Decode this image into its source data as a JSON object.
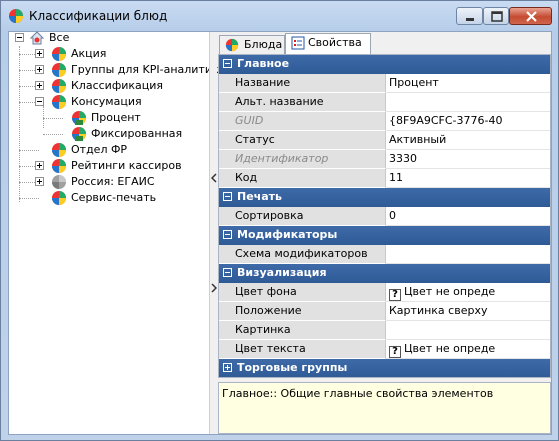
{
  "window": {
    "title": "Классификации блюд"
  },
  "tree": {
    "root": "Все",
    "items": [
      {
        "label": "Акция"
      },
      {
        "label": "Группы для KPI-аналитик"
      },
      {
        "label": "Классификация"
      },
      {
        "label": "Консумация"
      },
      {
        "label": "Процент"
      },
      {
        "label": "Фиксированная"
      },
      {
        "label": "Отдел ФР"
      },
      {
        "label": "Рейтинги кассиров"
      },
      {
        "label": "Россия: ЕГАИС"
      },
      {
        "label": "Сервис-печать"
      }
    ]
  },
  "tabs": [
    {
      "label": "Блюда"
    },
    {
      "label": "Свойства"
    }
  ],
  "properties": {
    "cat_main": "Главное",
    "name_label": "Название",
    "name_value": "Процент",
    "alt_name_label": "Альт. название",
    "alt_name_value": "",
    "guid_label": "GUID",
    "guid_value": "{8F9A9CFC-3776-40",
    "status_label": "Статус",
    "status_value": "Активный",
    "id_label": "Идентификатор",
    "id_value": "3330",
    "code_label": "Код",
    "code_value": "11",
    "cat_print": "Печать",
    "sort_label": "Сортировка",
    "sort_value": "0",
    "cat_mod": "Модификаторы",
    "mod_scheme_label": "Схема модификаторов",
    "mod_scheme_value": "",
    "cat_vis": "Визуализация",
    "bg_label": "Цвет фона",
    "bg_value": "Цвет не опреде",
    "pos_label": "Положение",
    "pos_value": "Картинка сверху",
    "pic_label": "Картинка",
    "pic_value": "",
    "text_color_label": "Цвет текста",
    "text_color_value": "Цвет не опреде",
    "qmark": "?",
    "cat_trade": "Торговые группы"
  },
  "description": "Главное:: Общие главные свойства элементов",
  "colors": {
    "category_bg": "#3e6aa8",
    "name_cell_bg": "#e1e1e1",
    "desc_bg": "#ffffe1"
  },
  "icons": {
    "app": "colored-ball-icon",
    "root": "home-folder-icon",
    "item": "colored-ball-icon",
    "tab_dishes": "colored-ball-icon",
    "tab_props": "properties-icon"
  }
}
